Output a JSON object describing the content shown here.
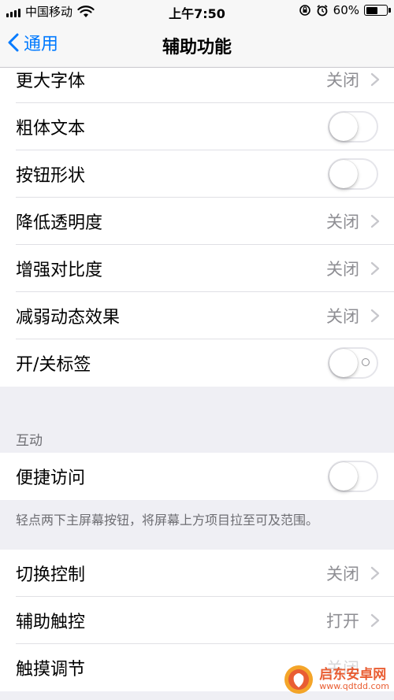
{
  "status_bar": {
    "carrier": "中国移动",
    "time": "上午7:50",
    "battery_percent_text": "60%",
    "battery_level": 0.6
  },
  "nav": {
    "back_label": "通用",
    "title": "辅助功能"
  },
  "group1": [
    {
      "label": "更大字体",
      "type": "disclosure",
      "value": "关闭"
    },
    {
      "label": "粗体文本",
      "type": "toggle",
      "on": false
    },
    {
      "label": "按钮形状",
      "type": "toggle",
      "on": false
    },
    {
      "label": "降低透明度",
      "type": "disclosure",
      "value": "关闭"
    },
    {
      "label": "增强对比度",
      "type": "disclosure",
      "value": "关闭"
    },
    {
      "label": "减弱动态效果",
      "type": "disclosure",
      "value": "关闭"
    },
    {
      "label": "开/关标签",
      "type": "toggle",
      "on": false
    }
  ],
  "interaction": {
    "header": "互动",
    "reachability_label": "便捷访问",
    "reachability_on": false,
    "footer": "轻点两下主屏幕按钮，将屏幕上方项目拉至可及范围。"
  },
  "group3": [
    {
      "label": "切换控制",
      "type": "disclosure",
      "value": "关闭"
    },
    {
      "label": "辅助触控",
      "type": "disclosure",
      "value": "打开"
    },
    {
      "label": "触摸调节",
      "type": "disclosure",
      "value": "关闭"
    }
  ],
  "watermark": {
    "name": "启东安卓网",
    "url": "www.qdtdd.com"
  },
  "colors": {
    "accent": "#007aff",
    "background": "#efeff4",
    "secondary_text": "#8e8e93",
    "watermark": "#e74c1c"
  }
}
